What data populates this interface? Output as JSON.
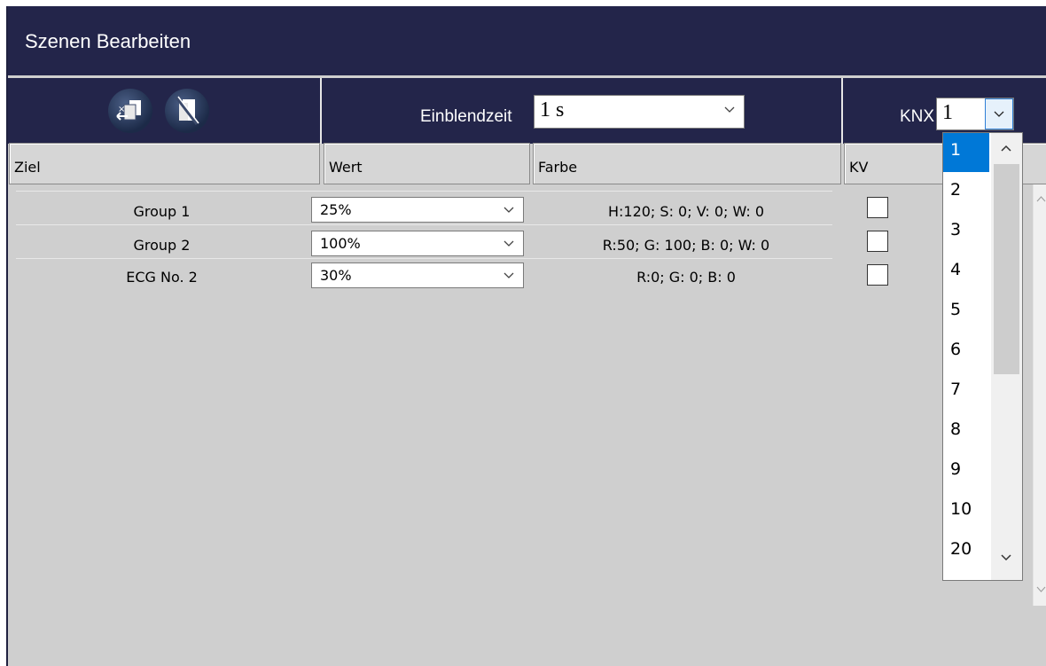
{
  "title": "Szenen Bearbeiten",
  "toolbar": {
    "icons": [
      "copy-scene-icon",
      "delete-scene-icon"
    ],
    "einblendzeit_label": "Einblendzeit",
    "einblendzeit_value": "1 s",
    "knx_label": "KNX",
    "knx_value": "1"
  },
  "columns": {
    "ziel": "Ziel",
    "wert": "Wert",
    "farbe": "Farbe",
    "kv": "KV"
  },
  "rows": [
    {
      "ziel": "Group 1",
      "wert": "25%",
      "farbe": "H:120; S: 0; V: 0; W: 0",
      "kv": false
    },
    {
      "ziel": "Group 2",
      "wert": "100%",
      "farbe": "R:50; G: 100; B: 0; W: 0",
      "kv": false
    },
    {
      "ziel": "ECG No. 2",
      "wert": "30%",
      "farbe": "R:0; G: 0; B: 0",
      "kv": false
    }
  ],
  "knx_dropdown": {
    "options": [
      "1",
      "2",
      "3",
      "4",
      "5",
      "6",
      "7",
      "8",
      "9",
      "10",
      "20"
    ],
    "selected": "1"
  },
  "colors": {
    "header_bg": "#23254a",
    "selection": "#0078d7",
    "grid_bg": "#cfcfcf"
  }
}
